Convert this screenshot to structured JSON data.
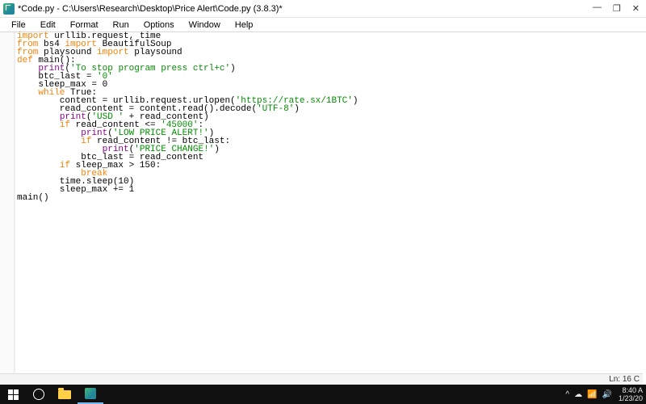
{
  "window": {
    "title": "*Code.py - C:\\Users\\Research\\Desktop\\Price Alert\\Code.py (3.8.3)*"
  },
  "menu": {
    "file": "File",
    "edit": "Edit",
    "format": "Format",
    "run": "Run",
    "options": "Options",
    "window": "Window",
    "help": "Help"
  },
  "code": {
    "l1_kw1": "import",
    "l1_rest": " urllib.request, time",
    "l2_kw1": "from",
    "l2_mid": " bs4 ",
    "l2_kw2": "import",
    "l2_rest": " BeautifulSoup",
    "l3_kw1": "from",
    "l3_mid": " playsound ",
    "l3_kw2": "import",
    "l3_rest": " playsound",
    "l4_kw": "def",
    "l4_rest": " main():",
    "l5_pre": "    ",
    "l5_fn": "print",
    "l5_open": "(",
    "l5_str": "'To stop program press ctrl+c'",
    "l5_close": ")",
    "l6_pre": "    btc_last = ",
    "l6_str": "'0'",
    "l7": "    sleep_max = 0",
    "l8_pre": "    ",
    "l8_kw": "while",
    "l8_rest": " True:",
    "l9_pre": "        content = urllib.request.urlopen(",
    "l9_str": "'https://rate.sx/1BTC'",
    "l9_close": ")",
    "l10_pre": "        read_content = content.read().decode(",
    "l10_str": "'UTF-8'",
    "l10_close": ")",
    "l11_pre": "        ",
    "l11_fn": "print",
    "l11_open": "(",
    "l11_str": "'USD '",
    "l11_rest": " + read_content)",
    "l12_pre": "        ",
    "l12_kw": "if",
    "l12_mid": " read_content <= ",
    "l12_str": "'45000'",
    "l12_rest": ":",
    "l13_pre": "            ",
    "l13_fn": "print",
    "l13_open": "(",
    "l13_str": "'LOW PRICE ALERT!'",
    "l13_close": ")",
    "l14_pre": "            ",
    "l14_kw": "if",
    "l14_rest": " read_content != btc_last:",
    "l15_pre": "                ",
    "l15_fn": "print",
    "l15_open": "(",
    "l15_str": "'PRICE CHANGE!'",
    "l15_close": ")",
    "l16": "            btc_last = read_content",
    "l17_pre": "        ",
    "l17_kw": "if",
    "l17_rest": " sleep_max > 150:",
    "l18_pre": "            ",
    "l18_kw": "break",
    "l19": "        time.sleep(10)",
    "l20": "        sleep_max += 1",
    "l21": "main()"
  },
  "status": {
    "text": "Ln: 16   C"
  },
  "tray": {
    "up": "^",
    "cloud": "☁",
    "wifi": "⚙",
    "sound": "🔊",
    "net": "📶"
  },
  "clock": {
    "time": "8:40 A",
    "date": "1/23/20"
  }
}
